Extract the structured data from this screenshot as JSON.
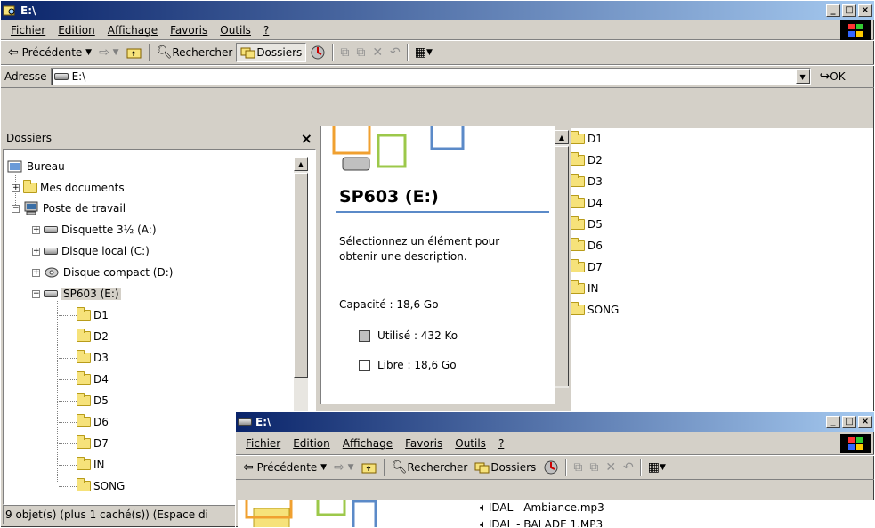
{
  "main_window": {
    "title": "E:\\",
    "menu": [
      "Fichier",
      "Edition",
      "Affichage",
      "Favoris",
      "Outils",
      "?"
    ],
    "toolbar": {
      "back": "Précédente",
      "search": "Rechercher",
      "folders": "Dossiers"
    },
    "address": {
      "label": "Adresse",
      "value": "E:\\",
      "go": "OK"
    },
    "folders_pane": {
      "title": "Dossiers",
      "close": "×"
    },
    "tree": {
      "desktop": "Bureau",
      "my_documents": "Mes documents",
      "my_computer": "Poste de travail",
      "floppy": "Disquette 3½ (A:)",
      "local_disk": "Disque local (C:)",
      "cd_drive": "Disque compact (D:)",
      "sp603": "SP603 (E:)",
      "children": [
        "D1",
        "D2",
        "D3",
        "D4",
        "D5",
        "D6",
        "D7",
        "IN",
        "SONG"
      ]
    },
    "info_panel": {
      "drive_title": "SP603 (E:)",
      "hint": "Sélectionnez un élément pour obtenir une description.",
      "capacity": "Capacité : 18,6 Go",
      "used": "Utilisé :  432 Ko",
      "free": "Libre :  18,6 Go"
    },
    "file_list": [
      "D1",
      "D2",
      "D3",
      "D4",
      "D5",
      "D6",
      "D7",
      "IN",
      "SONG"
    ],
    "status": "9 objet(s) (plus 1 caché(s)) (Espace di"
  },
  "second_window": {
    "title": "E:\\",
    "menu": [
      "Fichier",
      "Edition",
      "Affichage",
      "Favoris",
      "Outils",
      "?"
    ],
    "toolbar": {
      "back": "Précédente",
      "search": "Rechercher",
      "folders": "Dossiers"
    },
    "files": [
      "IDAL - Ambiance.mp3",
      "IDAL - BALADE 1.MP3"
    ]
  },
  "colors": {
    "title_start": "#0a246a",
    "title_end": "#a6caf0",
    "accent_line": "#5b8ac8"
  }
}
